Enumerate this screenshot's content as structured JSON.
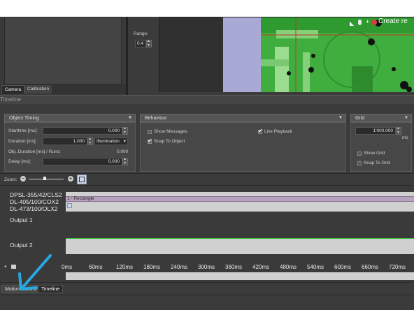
{
  "camera_view": {
    "range_label": "Range:",
    "range_value": "0.4",
    "overlay_text": "Create re"
  },
  "left_tabs": [
    "Camera",
    "Calibration"
  ],
  "timeline_title": "Timeline",
  "object_timing": {
    "header": "Object Timing",
    "starttime_label": "Starttime [ms]:",
    "starttime_value": "0.000",
    "duration_label": "Duration [ms]:",
    "duration_value": "1.000",
    "duration_mode": "Illumination",
    "obj_duration_label": "Obj. Duration [ms] / Runs:",
    "obj_duration_value": "0,000",
    "delay_label": "Delay [ms]:",
    "delay_value": "0.000"
  },
  "behaviour": {
    "header": "Behaviour",
    "show_messages": "Show Messages",
    "snap_to_object": "Snap To Object",
    "live_playback": "Live Playback"
  },
  "grid": {
    "header": "Grid",
    "value": "1'000.000",
    "unit": "ms",
    "show_grid": "Show Grid",
    "snap_to_grid": "Snap To Grid"
  },
  "zoom": {
    "label": "Zoom:",
    "level": 0.45
  },
  "tracks": {
    "lasers": [
      "DPSL-355/42/CLS2",
      "DL-405/100/COX2",
      "DL-473/100/OLX2"
    ],
    "rect_label": "1 - Rectangle",
    "output1": "Output 1",
    "output2": "Output 2"
  },
  "time_ticks": [
    "0ms",
    "60ms",
    "120ms",
    "180ms",
    "240ms",
    "300ms",
    "360ms",
    "420ms",
    "480ms",
    "540ms",
    "600ms",
    "660ms",
    "720ms"
  ],
  "bottom_tabs": [
    "Motion Control",
    "Timeline"
  ],
  "colors": {
    "accent_arrow": "#29a8e0",
    "clip": "#b8a2bf",
    "output_line": "#2fbf2f",
    "camera_green": "#3da83d",
    "lavender": "#a9a9d6"
  }
}
